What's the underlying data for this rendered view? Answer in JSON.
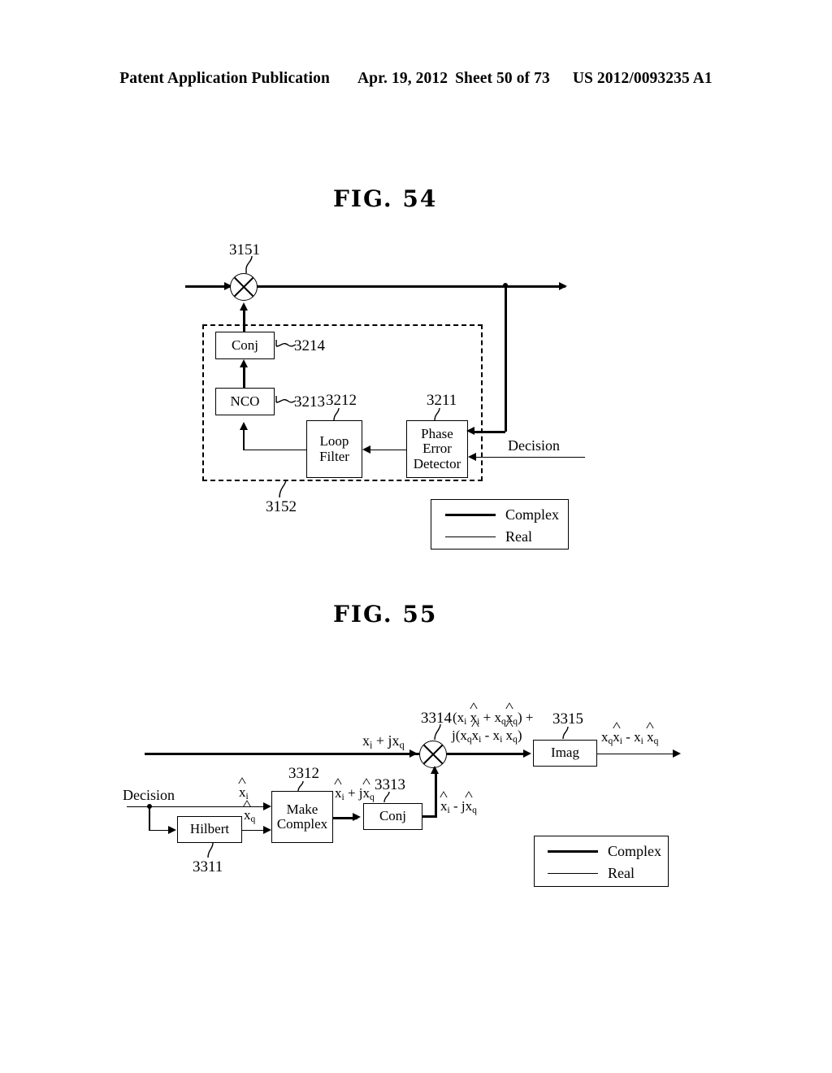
{
  "header": {
    "publication": "Patent Application Publication",
    "date": "Apr. 19, 2012",
    "sheet": "Sheet 50 of 73",
    "patent_number": "US 2012/0093235 A1"
  },
  "figures": [
    {
      "id": "fig54",
      "title": "FIG. 54",
      "blocks": [
        {
          "name": "conj",
          "label": "Conj",
          "ref": "3214"
        },
        {
          "name": "nco",
          "label": "NCO",
          "ref": "3213"
        },
        {
          "name": "loop-filter",
          "label_line1": "Loop",
          "label_line2": "Filter",
          "ref": "3212"
        },
        {
          "name": "phase-error-detector",
          "label_line1": "Phase",
          "label_line2": "Error",
          "label_line3": "Detector",
          "ref": "3211"
        }
      ],
      "multiplier_ref": "3151",
      "enclosure_ref": "3152",
      "signal_labels": [
        {
          "name": "decision-input",
          "text": "Decision"
        }
      ],
      "legend": {
        "complex": "Complex",
        "real": "Real"
      }
    },
    {
      "id": "fig55",
      "title": "FIG. 55",
      "blocks": [
        {
          "name": "hilbert",
          "label": "Hilbert",
          "ref": "3311"
        },
        {
          "name": "make-complex",
          "label_line1": "Make",
          "label_line2": "Complex",
          "ref": "3312"
        },
        {
          "name": "conj",
          "label": "Conj",
          "ref": "3313"
        },
        {
          "name": "imag",
          "label": "Imag",
          "ref": "3315"
        }
      ],
      "multiplier_ref": "3314",
      "signal_labels": [
        {
          "name": "input-signal",
          "text": "x_i + jx_q"
        },
        {
          "name": "decision-input",
          "text": "Decision"
        },
        {
          "name": "hilbert-in-xi",
          "text": "x̂_i"
        },
        {
          "name": "hilbert-out-xq",
          "text": "x̂_q"
        },
        {
          "name": "make-complex-out",
          "text": "x̂_i + jx̂_q"
        },
        {
          "name": "conj-out",
          "text": "x̂_i - jx̂_q"
        },
        {
          "name": "mult-out-line1",
          "text": "(x_i x̂_i + x_q x̂_q) +"
        },
        {
          "name": "mult-out-line2",
          "text": "j(x_q x̂_i - x_i x̂_q)"
        },
        {
          "name": "imag-out",
          "text": "x_q x̂_i - x_i x̂_q"
        }
      ],
      "legend": {
        "complex": "Complex",
        "real": "Real"
      }
    }
  ],
  "colors": {
    "ink": "#000000",
    "paper": "#ffffff"
  }
}
